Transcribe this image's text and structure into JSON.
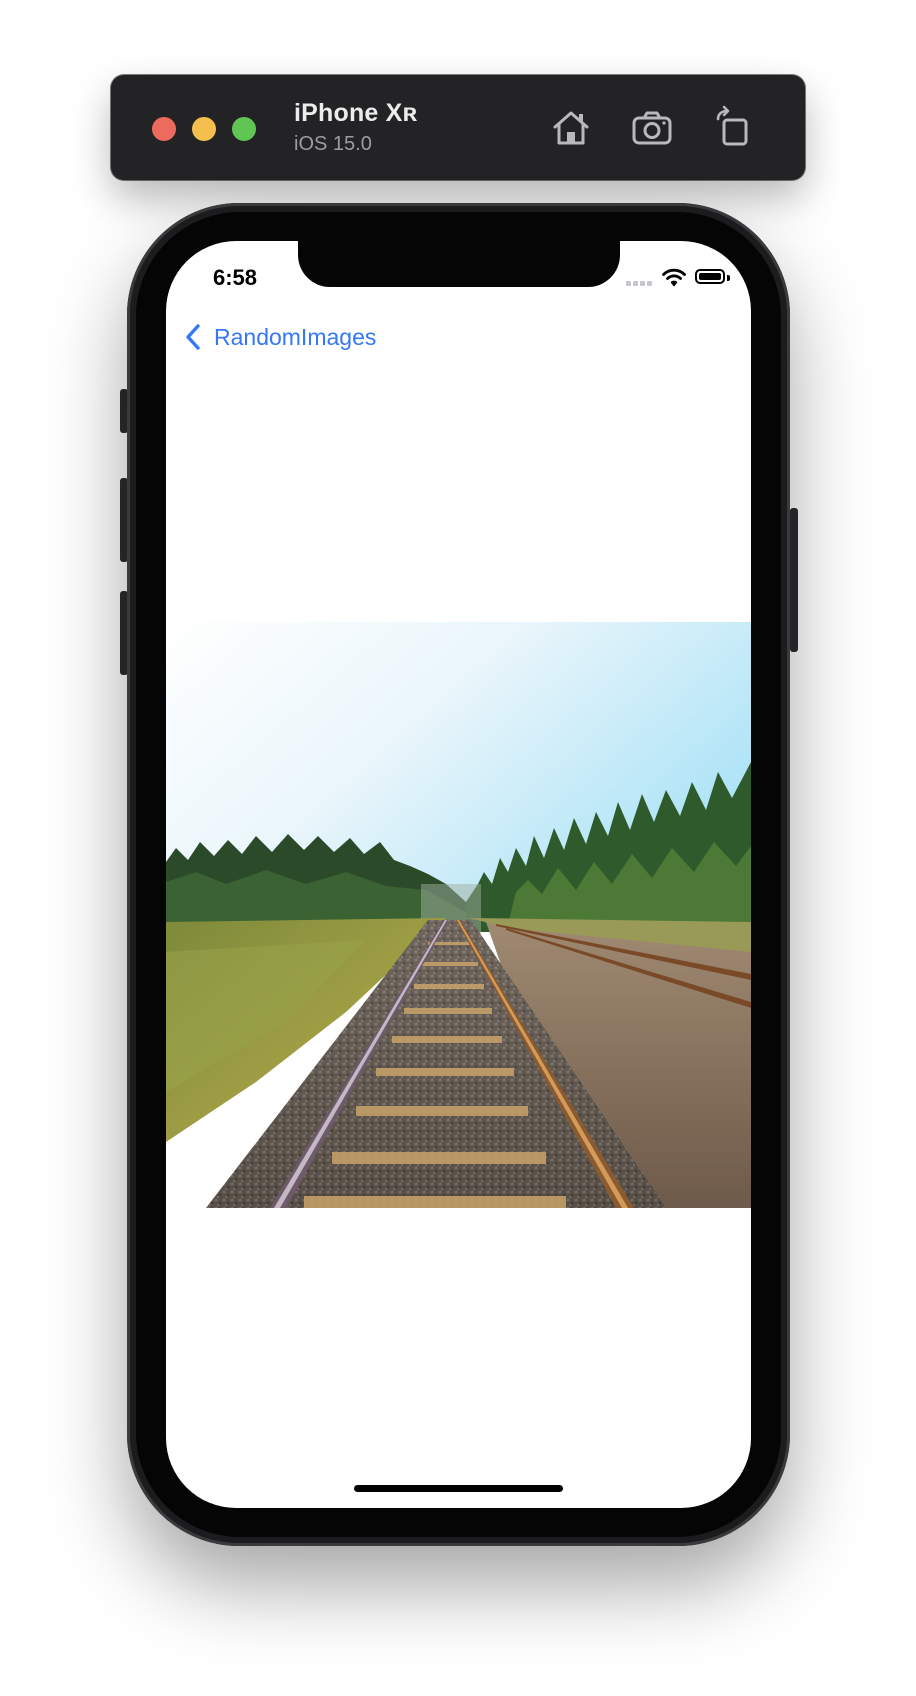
{
  "simulator": {
    "device_name": "iPhone Xʀ",
    "os_version": "iOS 15.0",
    "toolbar_icons": [
      "home-icon",
      "screenshot-icon",
      "rotate-icon"
    ],
    "traffic_lights": {
      "close_color": "#ec6a5e",
      "minimize_color": "#f4bf4f",
      "zoom_color": "#61c554"
    }
  },
  "status_bar": {
    "time": "6:58",
    "icons": [
      "cellular-signal-icon",
      "wifi-icon",
      "battery-icon"
    ]
  },
  "navigation": {
    "back_label": "RandomImages",
    "back_icon": "chevron-left-icon",
    "tint_color": "#3478f6"
  },
  "content": {
    "image_subject": "railway-tracks-through-forest"
  }
}
